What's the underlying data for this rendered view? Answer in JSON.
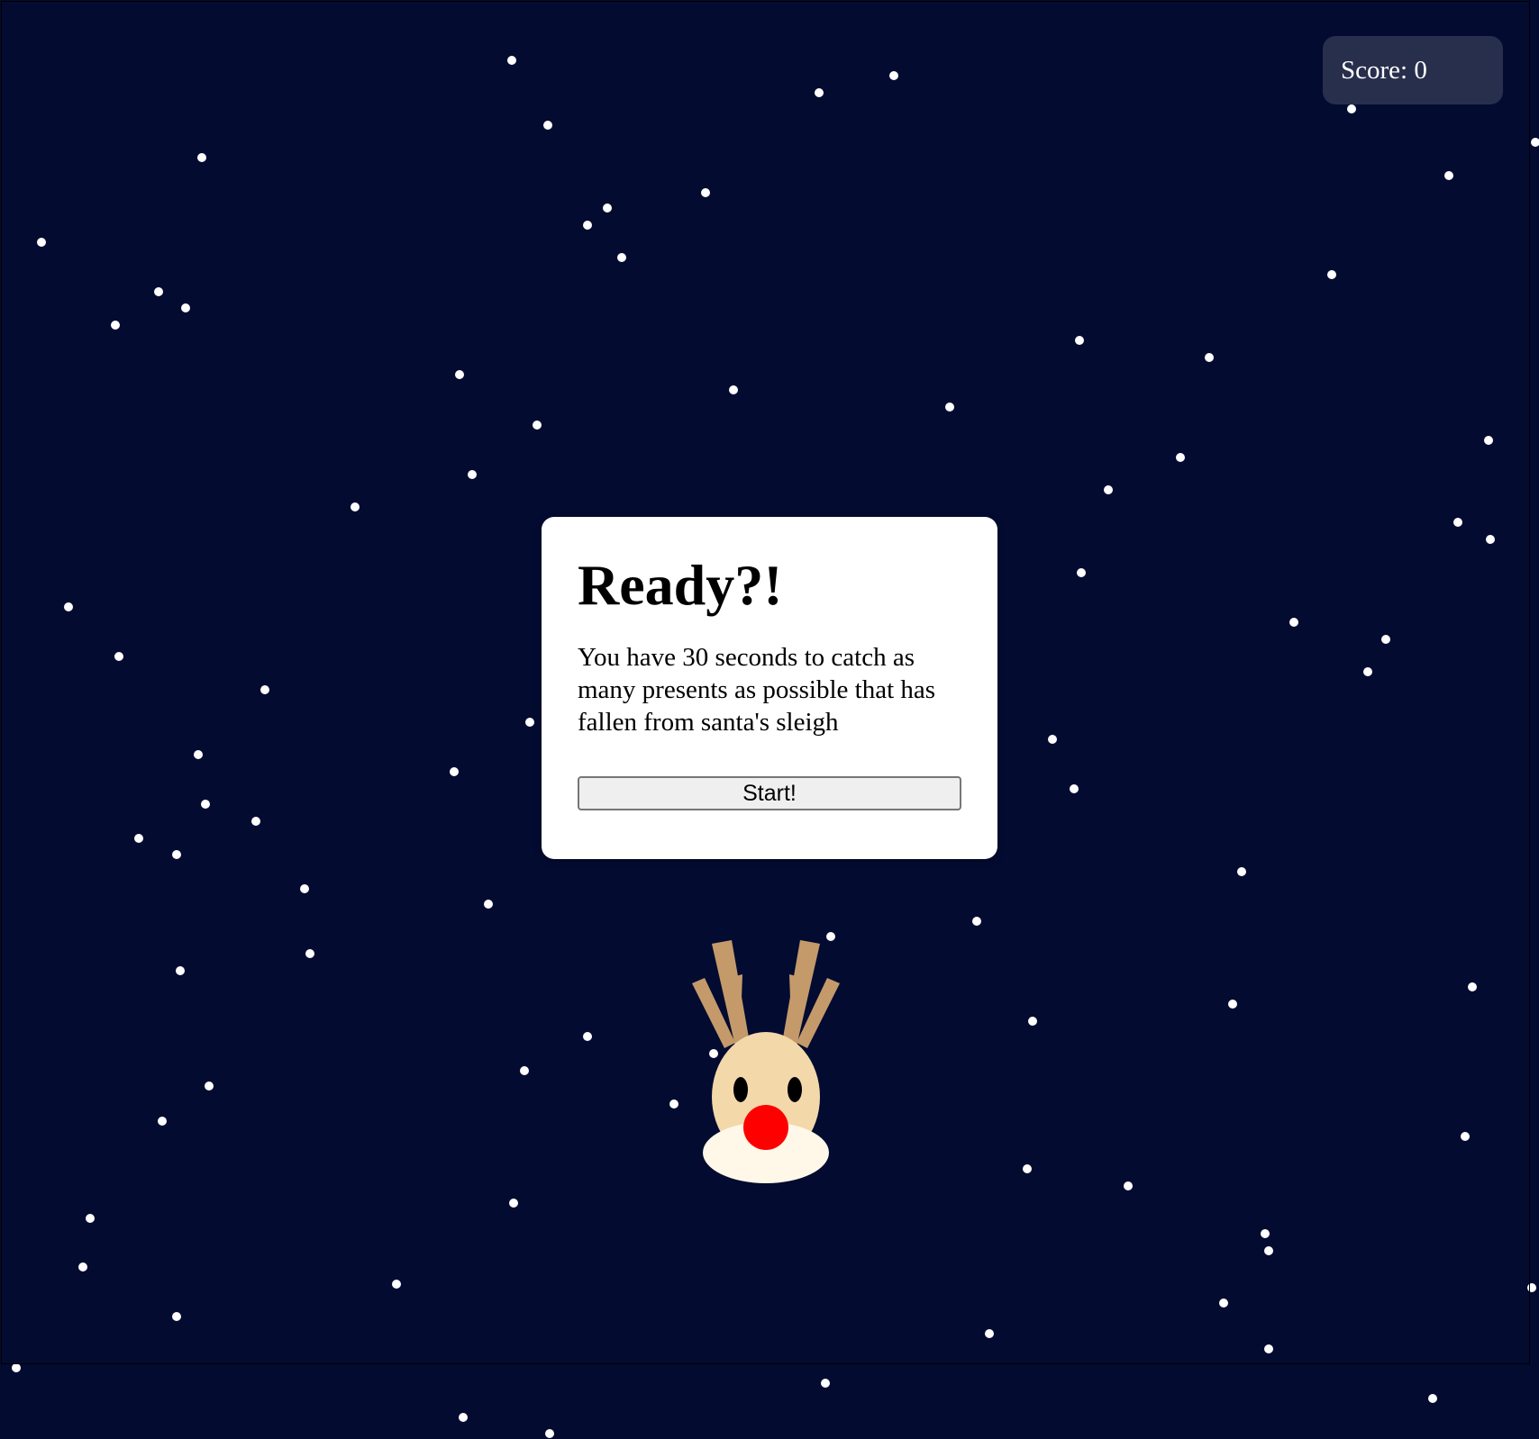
{
  "score": {
    "label": "Score: 0"
  },
  "modal": {
    "title": "Ready?!",
    "message": "You have 30 seconds to catch as many presents as possible that has fallen from santa's sleigh",
    "start_label": "Start!"
  },
  "colors": {
    "background": "#030b31",
    "score_bg": "#282f4c",
    "antler": "#c49a6a",
    "face": "#f3d8aa",
    "muzzle": "#fff8e8",
    "nose": "#ff0000"
  },
  "icons": {
    "player": "reindeer-icon",
    "snow": "snowflake-icon"
  }
}
